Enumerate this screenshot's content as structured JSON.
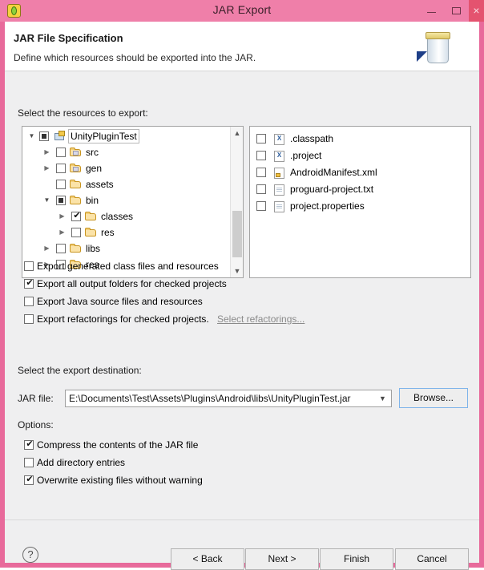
{
  "window": {
    "title": "JAR Export",
    "app_icon": "eclipse-icon",
    "minimize_label": "–",
    "maximize_label": "□",
    "close_label": "×"
  },
  "banner": {
    "title": "JAR File Specification",
    "subtitle": "Define which resources should be exported into the JAR.",
    "icon": "jar-icon"
  },
  "resources": {
    "label": "Select the resources to export:",
    "tree": [
      {
        "name": "UnityPluginTest",
        "icon": "java-project-icon",
        "indent": 0,
        "twisty": "open",
        "check": "partial",
        "selected": true
      },
      {
        "name": "src",
        "icon": "package-folder-icon",
        "indent": 1,
        "twisty": "closed",
        "check": "none",
        "selected": false
      },
      {
        "name": "gen",
        "icon": "package-folder-icon",
        "indent": 1,
        "twisty": "closed",
        "check": "none",
        "selected": false
      },
      {
        "name": "assets",
        "icon": "folder-icon",
        "indent": 1,
        "twisty": "none",
        "check": "none",
        "selected": false
      },
      {
        "name": "bin",
        "icon": "folder-icon",
        "indent": 1,
        "twisty": "open",
        "check": "partial",
        "selected": false
      },
      {
        "name": "classes",
        "icon": "folder-icon",
        "indent": 2,
        "twisty": "closed",
        "check": "checked",
        "selected": false
      },
      {
        "name": "res",
        "icon": "folder-icon",
        "indent": 2,
        "twisty": "closed",
        "check": "none",
        "selected": false
      },
      {
        "name": "libs",
        "icon": "folder-icon",
        "indent": 1,
        "twisty": "closed",
        "check": "none",
        "selected": false
      },
      {
        "name": "res",
        "icon": "folder-icon",
        "indent": 1,
        "twisty": "closed",
        "check": "none",
        "selected": false
      }
    ],
    "files": [
      {
        "name": ".classpath",
        "icon": "xml-file-icon",
        "check": "none"
      },
      {
        "name": ".project",
        "icon": "xml-file-icon",
        "check": "none"
      },
      {
        "name": "AndroidManifest.xml",
        "icon": "android-xml-icon",
        "check": "none"
      },
      {
        "name": "proguard-project.txt",
        "icon": "text-file-icon",
        "check": "none"
      },
      {
        "name": "project.properties",
        "icon": "text-file-icon",
        "check": "none"
      }
    ],
    "scrollbar": {
      "up": "▲",
      "down": "▼"
    }
  },
  "export_options": [
    {
      "label": "Export generated class files and resources",
      "checked": false
    },
    {
      "label": "Export all output folders for checked projects",
      "checked": true
    },
    {
      "label": "Export Java source files and resources",
      "checked": false
    },
    {
      "label": "Export refactorings for checked projects.",
      "checked": false,
      "link": "Select refactorings..."
    }
  ],
  "destination": {
    "label": "Select the export destination:",
    "field_label": "JAR file:",
    "value": "E:\\Documents\\Test\\Assets\\Plugins\\Android\\libs\\UnityPluginTest.jar",
    "dropdown_icon": "chevron-down-icon",
    "browse_label": "Browse..."
  },
  "options": {
    "label": "Options:",
    "items": [
      {
        "label": "Compress the contents of the JAR file",
        "checked": true
      },
      {
        "label": "Add directory entries",
        "checked": false
      },
      {
        "label": "Overwrite existing files without warning",
        "checked": true
      }
    ]
  },
  "footer": {
    "help_icon": "?",
    "back_label": "< Back",
    "next_label": "Next >",
    "finish_label": "Finish",
    "cancel_label": "Cancel"
  },
  "colors": {
    "frame": "#e86a9b",
    "titlebar": "#ef7fa9",
    "close_button": "#e4536f",
    "dialog_bg": "#efeff0",
    "banner_bg": "#ffffff",
    "focus_border": "#7eb4ea"
  }
}
